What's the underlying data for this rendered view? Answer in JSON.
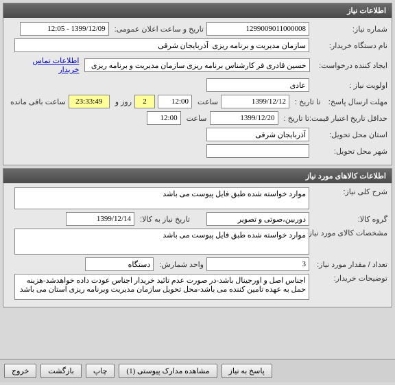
{
  "panel1": {
    "title": "اطلاعات نیاز",
    "need_number_label": "شماره نیاز:",
    "need_number": "1299009011000008",
    "announce_label": "تاریخ و ساعت اعلان عمومی:",
    "announce_value": "1399/12/09 - 12:05",
    "buyer_org_label": "نام دستگاه خریدار:",
    "buyer_org": "سازمان مدیریت و برنامه ریزی  آذربایجان شرقی",
    "creator_label": "ایجاد کننده درخواست:",
    "creator": "حسین قادری فر کارشناس برنامه ریزی سازمان مدیریت و برنامه ریزی  آذربایجان ش",
    "contact_link": "اطلاعات تماس خریدار",
    "priority_label": "اولویت نیاز :",
    "priority": "عادی",
    "deadline_label": "مهلت ارسال پاسخ:",
    "deadline_to_label": "تا تاریخ :",
    "deadline_date": "1399/12/12",
    "time_label": "ساعت",
    "deadline_time": "12:00",
    "days_remaining": "2",
    "days_label": "روز و",
    "time_remaining": "23:33:49",
    "remaining_label": "ساعت باقی مانده",
    "min_credit_label": "حداقل تاریخ اعتبار قیمت:",
    "min_credit_to": "تا تاریخ :",
    "min_credit_date": "1399/12/20",
    "min_credit_time": "12:00",
    "delivery_province_label": "استان محل تحویل:",
    "delivery_province": "آذربایجان شرقی",
    "delivery_city_label": "شهر محل تحویل:",
    "delivery_city": ""
  },
  "panel2": {
    "title": "اطلاعات کالاهای مورد نیاز",
    "general_desc_label": "شرح کلی نیاز:",
    "general_desc": "موارد خواسته شده طبق فایل پیوست می باشد",
    "goods_group_label": "گروه کالا:",
    "goods_group": "دوربین،صوتی و تصویر",
    "need_date_label": "تاریخ نیاز به کالا:",
    "need_date": "1399/12/14",
    "goods_spec_label": "مشخصات کالای مورد نیاز:",
    "goods_spec": "موارد خواسته شده طبق فایل پیوست می باشد",
    "quantity_label": "تعداد / مقدار مورد نیاز:",
    "quantity": "3",
    "unit_label": "واحد شمارش:",
    "unit": "دستگاه",
    "buyer_notes_label": "توضیحات خریدار:",
    "buyer_notes": "اجناس اصل و اورجینال باشد-در صورت عدم تائید خریدار اجناس عودت داده خواهدشد-هزینه حمل به عهده تامین کننده می باشد-محل تحویل سازمان مدیریت وبرنامه ریزی استان می باشد"
  },
  "buttons": {
    "respond": "پاسخ به نیاز",
    "attachments": "مشاهده مدارک پیوستی  (1)",
    "print": "چاپ",
    "back": "بازگشت",
    "exit": "خروج"
  }
}
